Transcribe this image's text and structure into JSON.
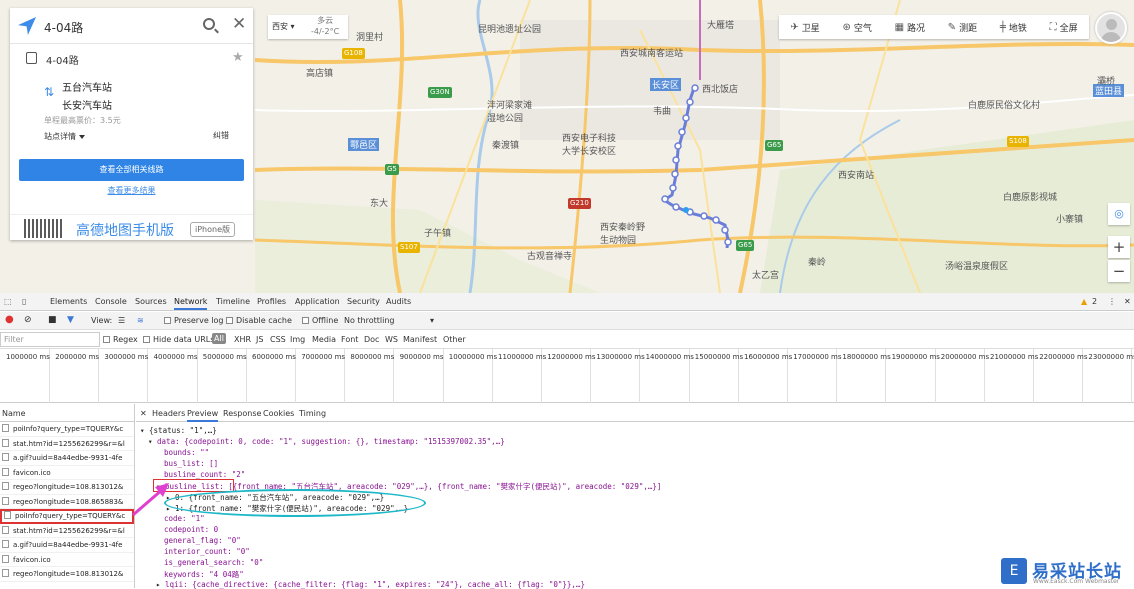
{
  "search": {
    "query": "4-04路"
  },
  "line_card": {
    "name": "4-04路",
    "stop_from": "五台汽车站",
    "stop_to": "长安汽车站",
    "fare": "单程最高票价：3.5元",
    "detail": "站点详情",
    "fix": "纠错",
    "all_lines_button": "查看全部相关线路",
    "more_results": "查看更多结果",
    "app_text": "高德地图手机版",
    "iphone_badge": "iPhone版"
  },
  "city_weather": {
    "city": "西安",
    "weather_line1": "多云",
    "weather_line2": "-4/-2°C"
  },
  "map_toolbar": [
    {
      "label": "卫星",
      "icon": "satellite-icon"
    },
    {
      "label": "空气",
      "icon": "air-icon"
    },
    {
      "label": "路况",
      "icon": "traffic-icon"
    },
    {
      "label": "测距",
      "icon": "ruler-icon"
    },
    {
      "label": "地铁",
      "icon": "subway-icon"
    },
    {
      "label": "全屏",
      "icon": "fullscreen-icon"
    }
  ],
  "map_labels": {
    "l1": "昆明池遗址公园",
    "l2": "西安城南客运站",
    "l3": "大雁塔",
    "l4": "西北饭店",
    "l5": "沣河梁家滩湿地公园",
    "l6": "西安电子科技大学长安校区",
    "l7": "白鹿原民俗文化村",
    "l8": "西安南站",
    "l9": "白鹿原影视城",
    "l10": "西安秦岭野生动物园",
    "l11": "古观音禅寺",
    "l12": "汤峪温泉度假区",
    "l13": "长安区",
    "l14": "鄠邑区",
    "l15": "蓝田县",
    "l16": "洞里村",
    "l17": "高店镇",
    "l18": "秦渡镇",
    "l19": "东大",
    "l20": "韦曲",
    "l21": "灞桥",
    "l22": "小寨镇",
    "l23": "太乙宫",
    "l24": "子午镇",
    "l25": "秦岭"
  },
  "map_roads": {
    "r1": "G108",
    "r2": "G30N",
    "r3": "G5",
    "r4": "G65",
    "r5": "S107",
    "r6": "G210",
    "r7": "S108",
    "r8": "G65"
  },
  "devtools": {
    "tabs": [
      "Elements",
      "Console",
      "Sources",
      "Network",
      "Timeline",
      "Profiles",
      "Application",
      "Security",
      "Audits"
    ],
    "active_tab": "Network",
    "warning_count": "2",
    "toolbar": {
      "view": "View:",
      "preserve_log": "Preserve log",
      "disable_cache": "Disable cache",
      "offline": "Offline",
      "throttling": "No throttling"
    },
    "filter": {
      "placeholder": "Filter",
      "regex": "Regex",
      "hide_data_urls": "Hide data URLs",
      "types": [
        "All",
        "XHR",
        "JS",
        "CSS",
        "Img",
        "Media",
        "Font",
        "Doc",
        "WS",
        "Manifest",
        "Other"
      ]
    },
    "timeline_ticks": [
      "1000000 ms",
      "2000000 ms",
      "3000000 ms",
      "4000000 ms",
      "5000000 ms",
      "6000000 ms",
      "7000000 ms",
      "8000000 ms",
      "9000000 ms",
      "10000000 ms",
      "11000000 ms",
      "12000000 ms",
      "13000000 ms",
      "14000000 ms",
      "15000000 ms",
      "16000000 ms",
      "17000000 ms",
      "18000000 ms",
      "19000000 ms",
      "20000000 ms",
      "21000000 ms",
      "22000000 ms",
      "23000000 ms"
    ],
    "name_header": "Name",
    "requests": [
      "poiInfo?query_type=TQUERY&c",
      "stat.htm?id=1255626299&r=&l",
      "a.gif?uuid=8a44edbe-9931-4fe",
      "favicon.ico",
      "regeo?longitude=108.813012&",
      "regeo?longitude=108.865883&",
      "poiInfo?query_type=TQUERY&c",
      "stat.htm?id=1255626299&r=&l",
      "a.gif?uuid=8a44edbe-9931-4fe",
      "favicon.ico",
      "regeo?longitude=108.813012&"
    ],
    "selected_request": 6,
    "preview_tabs": [
      "Headers",
      "Preview",
      "Response",
      "Cookies",
      "Timing"
    ],
    "active_preview_tab": "Preview",
    "json_lines": [
      "{status: \"1\",…}",
      "data: {codepoint: 0, code: \"1\", suggestion: {}, timestamp: \"1515397002.35\",…}",
      "bounds: \"\"",
      "bus_list: []",
      "busline_count: \"2\"",
      "busline_list: [{front_name: \"五台汽车站\", areacode: \"029\",…}, {front_name: \"樊家什字(便民站)\", areacode: \"029\",…}]",
      "0: {front_name: \"五台汽车站\", areacode: \"029\",…}",
      "1: {front_name: \"樊家什字(便民站)\", areacode: \"029\",…}",
      "code: \"1\"",
      "codepoint: 0",
      "general_flag: \"0\"",
      "interior_count: \"0\"",
      "is_general_search: \"0\"",
      "keywords: \"4 04路\"",
      "lqii: {cache_directive: {cache_filter: {flag: \"1\", expires: \"24\"}, cache_all: {flag: \"0\"}},…}"
    ]
  },
  "watermark": {
    "logo_char": "E",
    "title": "易采站长站",
    "subtitle": "Www.Easck.Com Webmaster"
  }
}
